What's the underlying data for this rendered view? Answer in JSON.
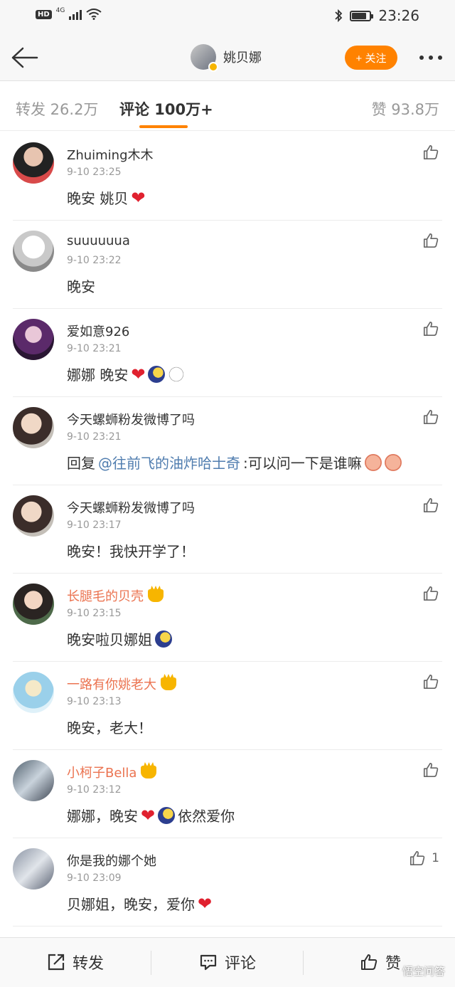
{
  "status_bar": {
    "hd": "HD",
    "network": "4G",
    "time": "23:26",
    "battery_level": 0.8
  },
  "nav": {
    "author_name": "姚贝娜",
    "follow_label": "+ 关注"
  },
  "tabs": {
    "forward": "转发 26.2万",
    "comments": "评论 100万+",
    "likes": "赞 93.8万"
  },
  "comments": [
    {
      "name": "Zhuiming木木",
      "time": "9-10 23:25",
      "text": "晚安 姚贝",
      "emojis": [
        "heart"
      ],
      "vip": false,
      "likes": ""
    },
    {
      "name": "suuuuuua",
      "time": "9-10 23:22",
      "text": "晚安",
      "emojis": [],
      "vip": false,
      "likes": ""
    },
    {
      "name": "爱如意926",
      "time": "9-10 23:21",
      "text": "娜娜 晚安",
      "emojis": [
        "heart",
        "moon",
        "ghost"
      ],
      "vip": false,
      "likes": ""
    },
    {
      "name": "今天螺蛳粉发微博了吗",
      "time": "9-10 23:21",
      "text_prefix": "回复",
      "mention": "@往前飞的油炸哈士奇",
      "text": ":可以问一下是谁嘛",
      "emojis": [
        "pig",
        "pig"
      ],
      "vip": false,
      "likes": ""
    },
    {
      "name": "今天螺蛳粉发微博了吗",
      "time": "9-10 23:17",
      "text": "晚安！我快开学了！",
      "emojis": [],
      "vip": false,
      "likes": ""
    },
    {
      "name": "长腿毛的贝壳",
      "time": "9-10 23:15",
      "text": "晚安啦贝娜姐",
      "emojis": [
        "moon"
      ],
      "vip": true,
      "likes": ""
    },
    {
      "name": "一路有你姚老大",
      "time": "9-10 23:13",
      "text": "晚安，老大！",
      "emojis": [],
      "vip": true,
      "likes": ""
    },
    {
      "name": "小柯子Bella",
      "time": "9-10 23:12",
      "text": "娜娜，晚安",
      "emojis": [
        "heart",
        "moon"
      ],
      "text_suffix": " 依然爱你",
      "vip": true,
      "likes": ""
    },
    {
      "name": "你是我的娜个她",
      "time": "9-10 23:09",
      "text": "贝娜姐，晚安，爱你",
      "emojis": [
        "heart"
      ],
      "vip": false,
      "likes": "1"
    }
  ],
  "bottom_bar": {
    "forward": "转发",
    "comment": "评论",
    "like": "赞",
    "watermark": "悟空问答"
  },
  "colors": {
    "accent": "#ff8200",
    "mention": "#507daf",
    "vip_name": "#eb7350"
  }
}
